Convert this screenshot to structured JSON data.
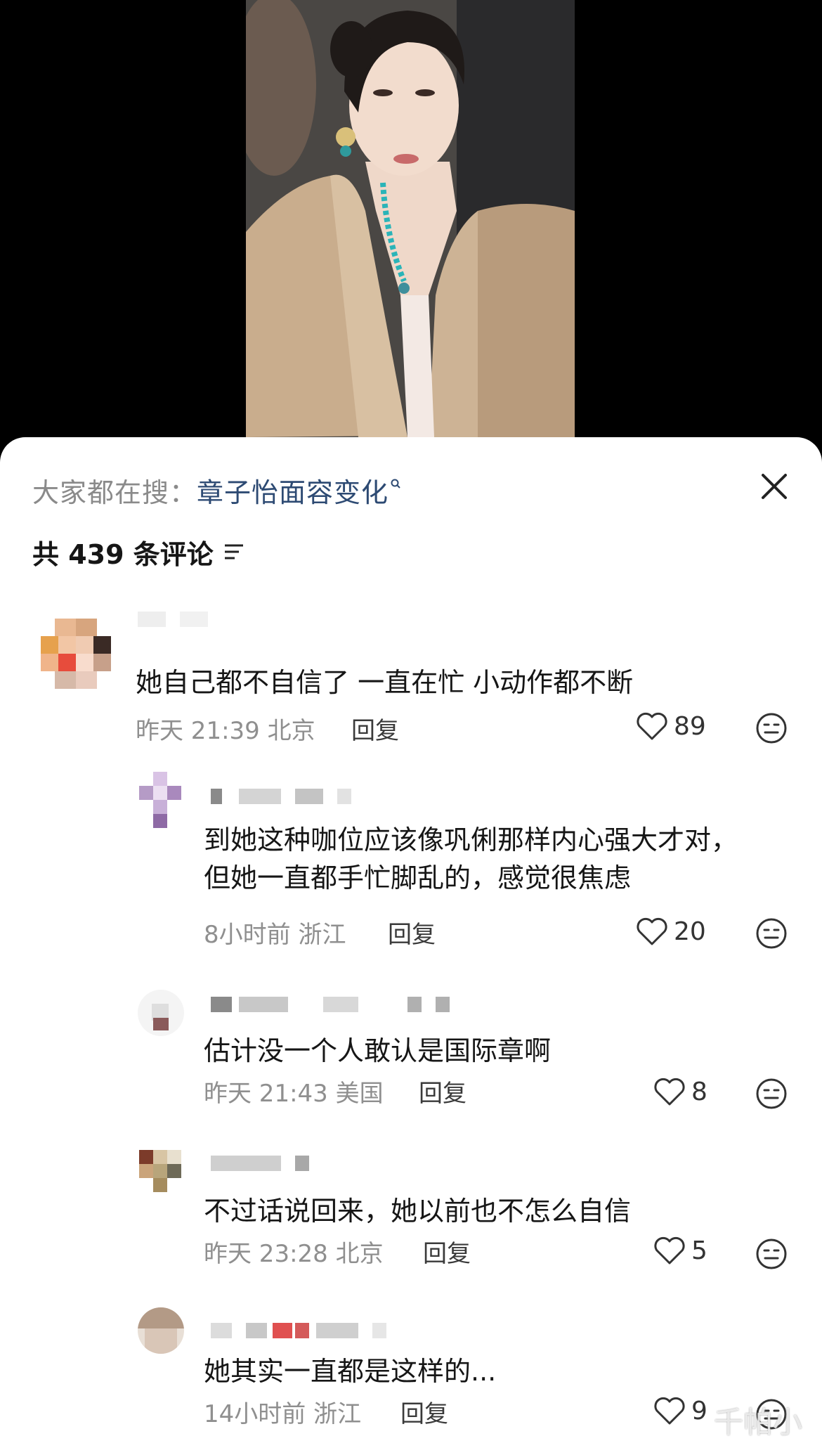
{
  "colors": {
    "background_dark": "#000000",
    "sheet": "#ffffff",
    "search_term": "#2d4a73",
    "muted": "#8f8f8f"
  },
  "search": {
    "prefix": "大家都在搜：",
    "term": "章子怡面容变化",
    "icon": "search-icon"
  },
  "header": {
    "count_text": "共 439 条评论",
    "sort_icon": "sort-icon",
    "close_icon": "close-icon"
  },
  "comments": [
    {
      "text": "她自己都不自信了 一直在忙 小动作都不断",
      "time": "昨天 21:39 北京",
      "reply": "回复",
      "likes": "89"
    },
    {
      "lines": [
        "到她这种咖位应该像巩俐那样内心强大才对，",
        "但她一直都手忙脚乱的，感觉很焦虑"
      ],
      "time": "8小时前 浙江",
      "reply": "回复",
      "likes": "20"
    },
    {
      "text": "估计没一个人敢认是国际章啊",
      "time": "昨天 21:43 美国",
      "reply": "回复",
      "likes": "8"
    },
    {
      "text": "不过话说回来，她以前也不怎么自信",
      "time": "昨天 23:28 北京",
      "reply": "回复",
      "likes": "5"
    },
    {
      "text": "她其实一直都是这样的...",
      "time": "14小时前 浙江",
      "reply": "回复",
      "likes": "9"
    }
  ],
  "watermark": "千帕小"
}
